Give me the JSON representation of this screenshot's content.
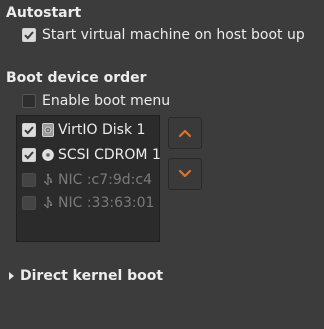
{
  "autostart": {
    "title": "Autostart",
    "checkbox_label": "Start virtual machine on host boot up",
    "checked": true
  },
  "boot_order": {
    "title": "Boot device order",
    "boot_menu_label": "Enable boot menu",
    "boot_menu_checked": false,
    "devices": [
      {
        "label": "VirtIO Disk 1",
        "checked": true,
        "enabled": true,
        "icon": "disk-icon"
      },
      {
        "label": "SCSI CDROM 1",
        "checked": true,
        "enabled": true,
        "icon": "cdrom-icon"
      },
      {
        "label": "NIC :c7:9d:c4",
        "checked": false,
        "enabled": false,
        "icon": "network-icon"
      },
      {
        "label": "NIC :33:63:01",
        "checked": false,
        "enabled": false,
        "icon": "network-icon"
      }
    ],
    "move_up_icon": "chevron-up-icon",
    "move_down_icon": "chevron-down-icon",
    "accent_color": "#e0702c"
  },
  "direct_kernel": {
    "title": "Direct kernel boot",
    "expanded": false
  }
}
